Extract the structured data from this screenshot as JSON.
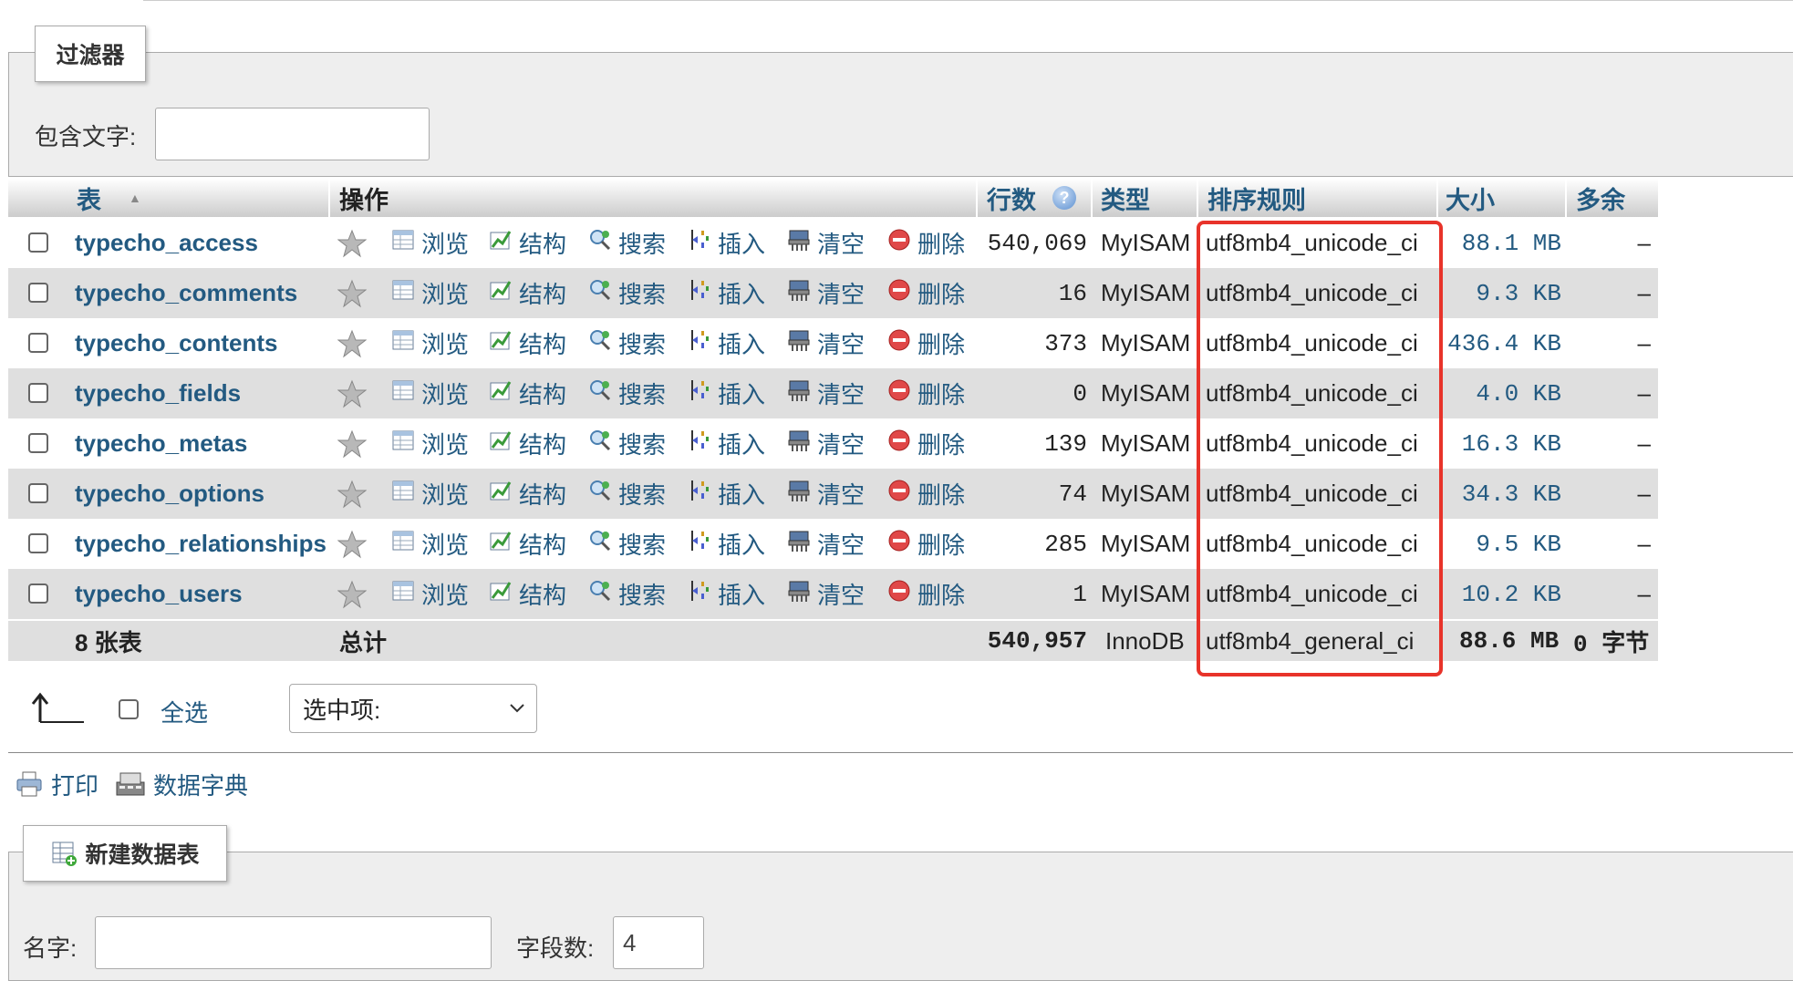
{
  "filter": {
    "legend": "过滤器",
    "contains_label": "包含文字:",
    "contains_value": ""
  },
  "table": {
    "headers": {
      "table": "表",
      "actions": "操作",
      "rows": "行数",
      "type": "类型",
      "collation": "排序规则",
      "size": "大小",
      "overhead": "多余"
    },
    "action_labels": {
      "browse": "浏览",
      "structure": "结构",
      "search": "搜索",
      "insert": "插入",
      "empty": "清空",
      "drop": "删除"
    },
    "rows": [
      {
        "name": "typecho_access",
        "rows": "540,069",
        "type": "MyISAM",
        "collation": "utf8mb4_unicode_ci",
        "size": "88.1 MB",
        "overhead": "–"
      },
      {
        "name": "typecho_comments",
        "rows": "16",
        "type": "MyISAM",
        "collation": "utf8mb4_unicode_ci",
        "size": "9.3 KB",
        "overhead": "–"
      },
      {
        "name": "typecho_contents",
        "rows": "373",
        "type": "MyISAM",
        "collation": "utf8mb4_unicode_ci",
        "size": "436.4 KB",
        "overhead": "–"
      },
      {
        "name": "typecho_fields",
        "rows": "0",
        "type": "MyISAM",
        "collation": "utf8mb4_unicode_ci",
        "size": "4.0 KB",
        "overhead": "–"
      },
      {
        "name": "typecho_metas",
        "rows": "139",
        "type": "MyISAM",
        "collation": "utf8mb4_unicode_ci",
        "size": "16.3 KB",
        "overhead": "–"
      },
      {
        "name": "typecho_options",
        "rows": "74",
        "type": "MyISAM",
        "collation": "utf8mb4_unicode_ci",
        "size": "34.3 KB",
        "overhead": "–"
      },
      {
        "name": "typecho_relationships",
        "rows": "285",
        "type": "MyISAM",
        "collation": "utf8mb4_unicode_ci",
        "size": "9.5 KB",
        "overhead": "–"
      },
      {
        "name": "typecho_users",
        "rows": "1",
        "type": "MyISAM",
        "collation": "utf8mb4_unicode_ci",
        "size": "10.2 KB",
        "overhead": "–"
      }
    ],
    "footer": {
      "count": "8 张表",
      "total": "总计",
      "rows": "540,957",
      "type": "InnoDB",
      "collation": "utf8mb4_general_ci",
      "size": "88.6 MB",
      "overhead": "0 字节"
    }
  },
  "bulk": {
    "select_all": "全选",
    "with_selected": "选中项:"
  },
  "links": {
    "print": "打印",
    "data_dictionary": "数据字典"
  },
  "create": {
    "legend": "新建数据表",
    "name_label": "名字:",
    "name_value": "",
    "fields_label": "字段数:",
    "fields_value": "4"
  },
  "colors": {
    "link": "#235a81",
    "highlight_box": "#e8332a",
    "row_alt": "#dfdfdf"
  }
}
